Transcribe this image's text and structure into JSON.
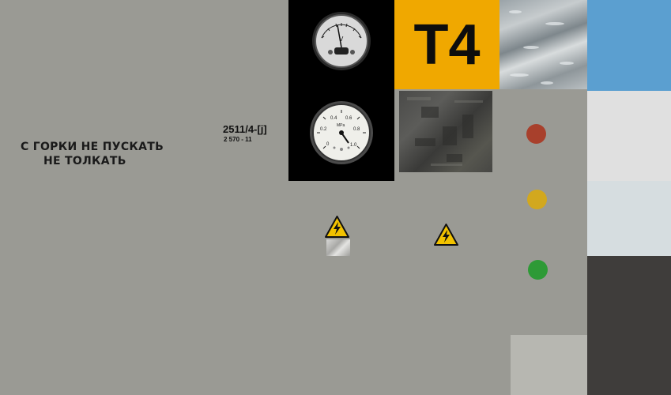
{
  "wagon_stencil": {
    "line1": "С ГОРКИ НЕ ПУСКАТЬ",
    "line2": "НЕ ТОЛКАТЬ"
  },
  "serial": {
    "number": "2511/4-[j]",
    "sub": "2 570 - 11"
  },
  "voltmeter": {
    "unit": "V",
    "tick_labels": [
      "0",
      "10",
      "20",
      "30",
      "40",
      "50"
    ]
  },
  "pressure_gauge": {
    "unit": "MPa",
    "tick_labels": [
      "0",
      "0.2",
      "0.4",
      "0.6",
      "0.8",
      "1.0"
    ]
  },
  "plate": {
    "text": "T4",
    "color": "#f0a800"
  },
  "signal_lights": [
    {
      "name": "red",
      "color": "#a8402c"
    },
    {
      "name": "yellow",
      "color": "#d2a81e"
    },
    {
      "name": "green",
      "color": "#2e9a36"
    }
  ],
  "palette": {
    "blue": "#5b9fd0",
    "light_gray": "#e0e0e0",
    "pale_blue_gray": "#d6dde0",
    "dark_gray": "#3f3d3b",
    "panel_gray": "#b7b7b1"
  },
  "icons": [
    "high-voltage-warning-icon",
    "high-voltage-warning-icon"
  ]
}
